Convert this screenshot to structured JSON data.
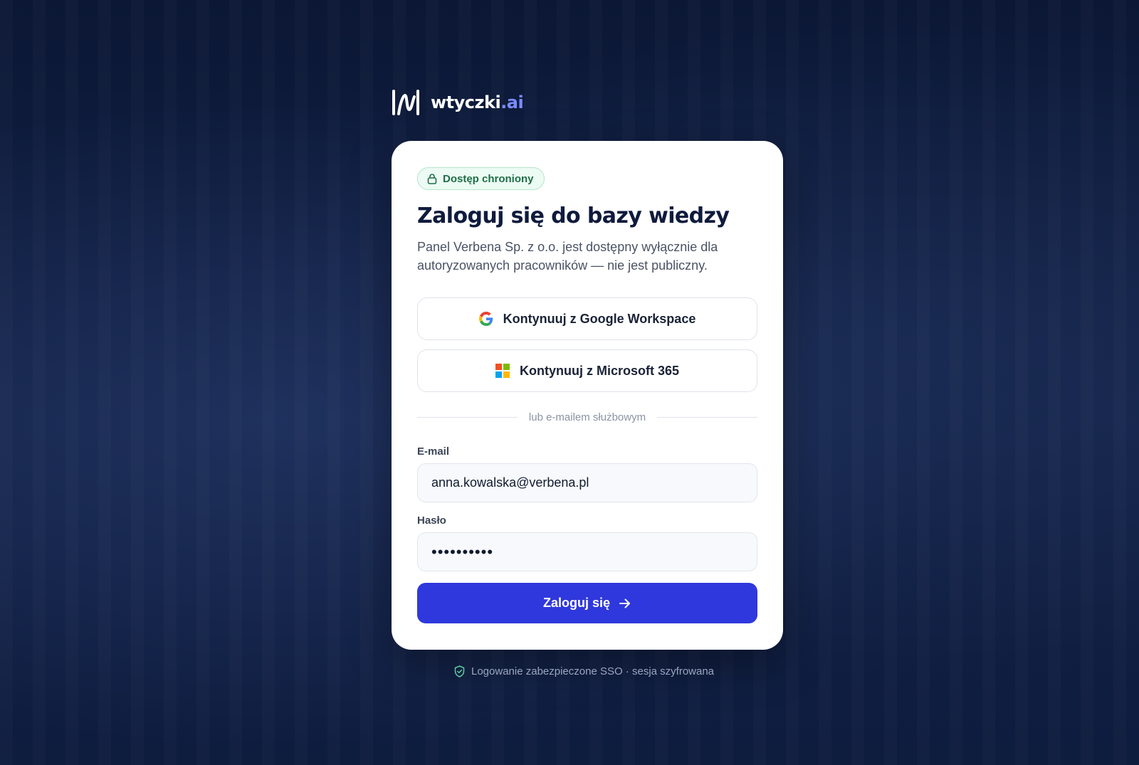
{
  "brand": {
    "name_main": "wtyczki",
    "name_accent": ".ai",
    "icon": "wtyczki-logo-icon"
  },
  "badge": {
    "label": "Dostęp chroniony",
    "icon": "lock-icon"
  },
  "header": {
    "title": "Zaloguj się do bazy wiedzy",
    "subtitle": "Panel Verbena Sp. z o.o. jest dostępny wyłącznie dla autoryzowanych pracowników — nie jest publiczny."
  },
  "sso": {
    "google_label": "Kontynuuj z Google Workspace",
    "google_icon": "google-icon",
    "microsoft_label": "Kontynuuj z Microsoft 365",
    "microsoft_icon": "microsoft-icon"
  },
  "divider": {
    "label": "lub e-mailem służbowym"
  },
  "form": {
    "email_label": "E-mail",
    "email_value": "anna.kowalska@verbena.pl",
    "password_label": "Hasło",
    "password_value": "••••••••••",
    "submit_label": "Zaloguj się",
    "submit_icon": "arrow-right-icon"
  },
  "footer": {
    "note": "Logowanie zabezpieczone SSO · sesja szyfrowana",
    "icon": "shield-check-icon"
  },
  "colors": {
    "background": "#0f1d3f",
    "primary": "#2f38dc",
    "brand_accent": "#7b8cff",
    "badge_green": "#1f6e47"
  }
}
